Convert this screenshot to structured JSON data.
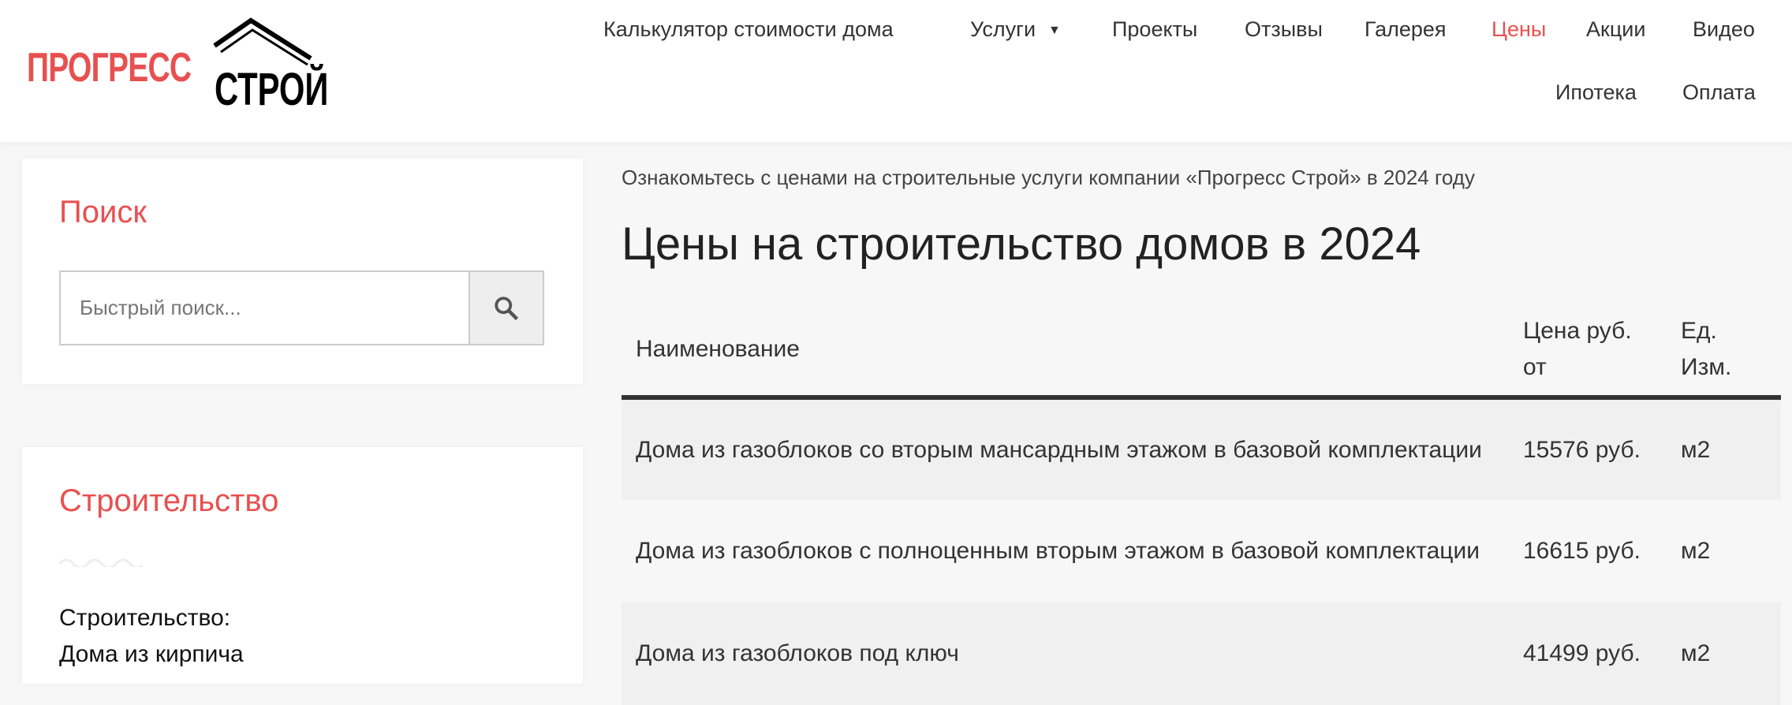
{
  "logo": {
    "word1": "ПРОГРЕСС",
    "word2": "СТРОЙ"
  },
  "nav": [
    {
      "label": "Калькулятор стоимости дома"
    },
    {
      "label": "Услуги",
      "has_dropdown": true
    },
    {
      "label": "Проекты"
    },
    {
      "label": "Отзывы"
    },
    {
      "label": "Галерея"
    },
    {
      "label": "Цены",
      "active": true
    },
    {
      "label": "Акции"
    },
    {
      "label": "Видео"
    },
    {
      "label": "Ипотека"
    },
    {
      "label": "Оплата"
    }
  ],
  "sidebar": {
    "search": {
      "title": "Поиск",
      "placeholder": "Быстрый поиск...",
      "icon": "search-icon"
    },
    "construction": {
      "title": "Строительство",
      "items": [
        "Строительство:",
        "Дома из кирпича"
      ]
    }
  },
  "main": {
    "intro": "Ознакомьтесь с ценами на строительные услуги компании «Прогресс Строй» в 2024 году",
    "title": "Цены на строительство домов в 2024",
    "table": {
      "headers": [
        "Наименование",
        "Цена руб. от",
        "Ед. Изм."
      ],
      "rows": [
        [
          "Дома из газоблоков со вторым мансардным этажом в базовой комплектации",
          "15576 руб.",
          "м2"
        ],
        [
          "Дома из газоблоков с полноценным вторым этажом в базовой комплектации",
          "16615 руб.",
          "м2"
        ],
        [
          "Дома из газоблоков под ключ",
          "41499 руб.",
          "м2"
        ]
      ]
    }
  },
  "colors": {
    "accent": "#e85050",
    "text": "#333333",
    "row_alt": "#f0f0f0"
  }
}
